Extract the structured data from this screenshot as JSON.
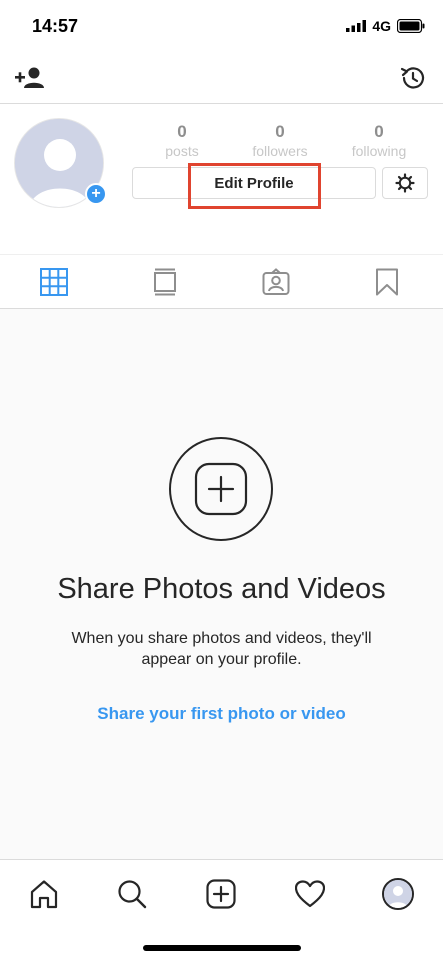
{
  "status_bar": {
    "time": "14:57",
    "network": "4G"
  },
  "profile": {
    "stats": [
      {
        "count": "0",
        "label": "posts"
      },
      {
        "count": "0",
        "label": "followers"
      },
      {
        "count": "0",
        "label": "following"
      }
    ],
    "edit_label": "Edit Profile",
    "avatar_plus": "+"
  },
  "empty_state": {
    "title": "Share Photos and Videos",
    "description": "When you share photos and videos, they'll appear on your profile.",
    "link": "Share your first photo or video"
  },
  "colors": {
    "accent": "#3897f0",
    "highlight": "#e0442f",
    "text": "#262626",
    "muted": "#8e8e8e"
  },
  "icons": {
    "top_left": "add-user-icon",
    "top_right": "history-icon",
    "tabs": [
      "grid-icon",
      "feed-icon",
      "tagged-icon",
      "saved-icon"
    ],
    "bottom_nav": [
      "home-icon",
      "search-icon",
      "add-post-icon",
      "heart-icon",
      "profile-avatar"
    ]
  }
}
